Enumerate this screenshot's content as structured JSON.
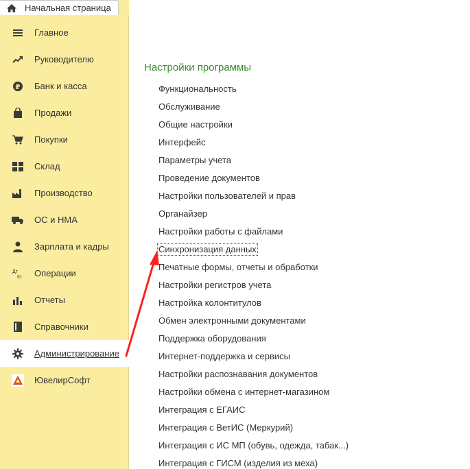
{
  "tab": {
    "label": "Начальная страница",
    "icon": "home-icon"
  },
  "sidebar": {
    "items": [
      {
        "label": "Главное",
        "icon": "menu-lines-icon"
      },
      {
        "label": "Руководителю",
        "icon": "trend-up-icon"
      },
      {
        "label": "Банк и касса",
        "icon": "ruble-coin-icon"
      },
      {
        "label": "Продажи",
        "icon": "shopping-bag-icon"
      },
      {
        "label": "Покупки",
        "icon": "cart-icon"
      },
      {
        "label": "Склад",
        "icon": "warehouse-icon"
      },
      {
        "label": "Производство",
        "icon": "factory-icon"
      },
      {
        "label": "ОС и НМА",
        "icon": "truck-icon"
      },
      {
        "label": "Зарплата и кадры",
        "icon": "person-icon"
      },
      {
        "label": "Операции",
        "icon": "dt-kt-icon",
        "icon_text_top": "Дт",
        "icon_text_bottom": "Кт"
      },
      {
        "label": "Отчеты",
        "icon": "bar-chart-icon"
      },
      {
        "label": "Справочники",
        "icon": "book-icon"
      },
      {
        "label": "Администрирование",
        "icon": "gear-icon",
        "active": true
      },
      {
        "label": "ЮвелирСофт",
        "icon": "jeweler-logo-icon"
      }
    ]
  },
  "main": {
    "title": "Настройки программы",
    "links": [
      "Функциональность",
      "Обслуживание",
      "Общие настройки",
      "Интерфейс",
      "Параметры учета",
      "Проведение документов",
      "Настройки пользователей и прав",
      "Органайзер",
      "Настройки работы с файлами",
      "Синхронизация данных",
      "Печатные формы, отчеты и обработки",
      "Настройки регистров учета",
      "Настройка колонтитулов",
      "Обмен электронными документами",
      "Поддержка оборудования",
      "Интернет-поддержка и сервисы",
      "Настройки распознавания документов",
      "Настройки обмена с интернет-магазином",
      "Интеграция с ЕГАИС",
      "Интеграция с ВетИС (Меркурий)",
      "Интеграция с ИС МП (обувь, одежда, табак...)",
      "Интеграция с ГИСМ (изделия из меха)"
    ],
    "focused_index": 9
  },
  "colors": {
    "sidebar_bg": "#fbeda0",
    "title_green": "#3a8a2e",
    "arrow_red": "#ff2020",
    "icon_dark": "#3b3b3b"
  }
}
